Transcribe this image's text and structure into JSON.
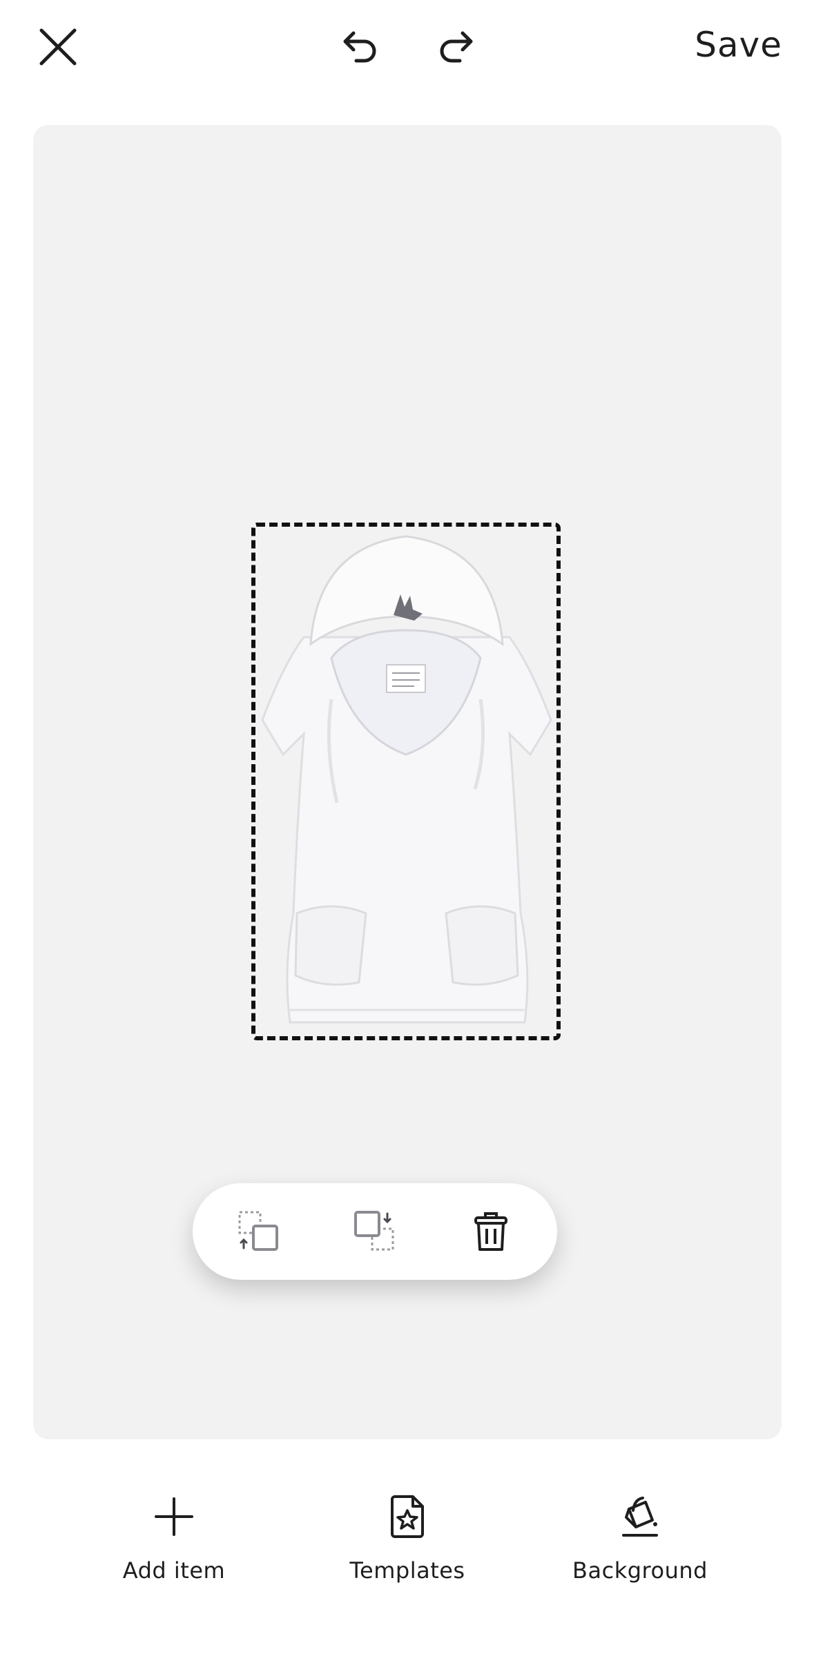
{
  "header": {
    "close_icon": "close-icon",
    "undo_icon": "undo-icon",
    "redo_icon": "redo-icon",
    "save_label": "Save"
  },
  "canvas": {
    "background_color": "#f2f2f2",
    "selected_item": "white-hooded-sweatshirt-dress"
  },
  "floating_toolbar": {
    "items": [
      {
        "icon": "send-backward-icon"
      },
      {
        "icon": "bring-forward-icon"
      },
      {
        "icon": "trash-icon"
      }
    ]
  },
  "bottom_bar": {
    "items": [
      {
        "icon": "plus-icon",
        "label": "Add item"
      },
      {
        "icon": "template-star-icon",
        "label": "Templates"
      },
      {
        "icon": "paint-bucket-icon",
        "label": "Background"
      }
    ]
  }
}
